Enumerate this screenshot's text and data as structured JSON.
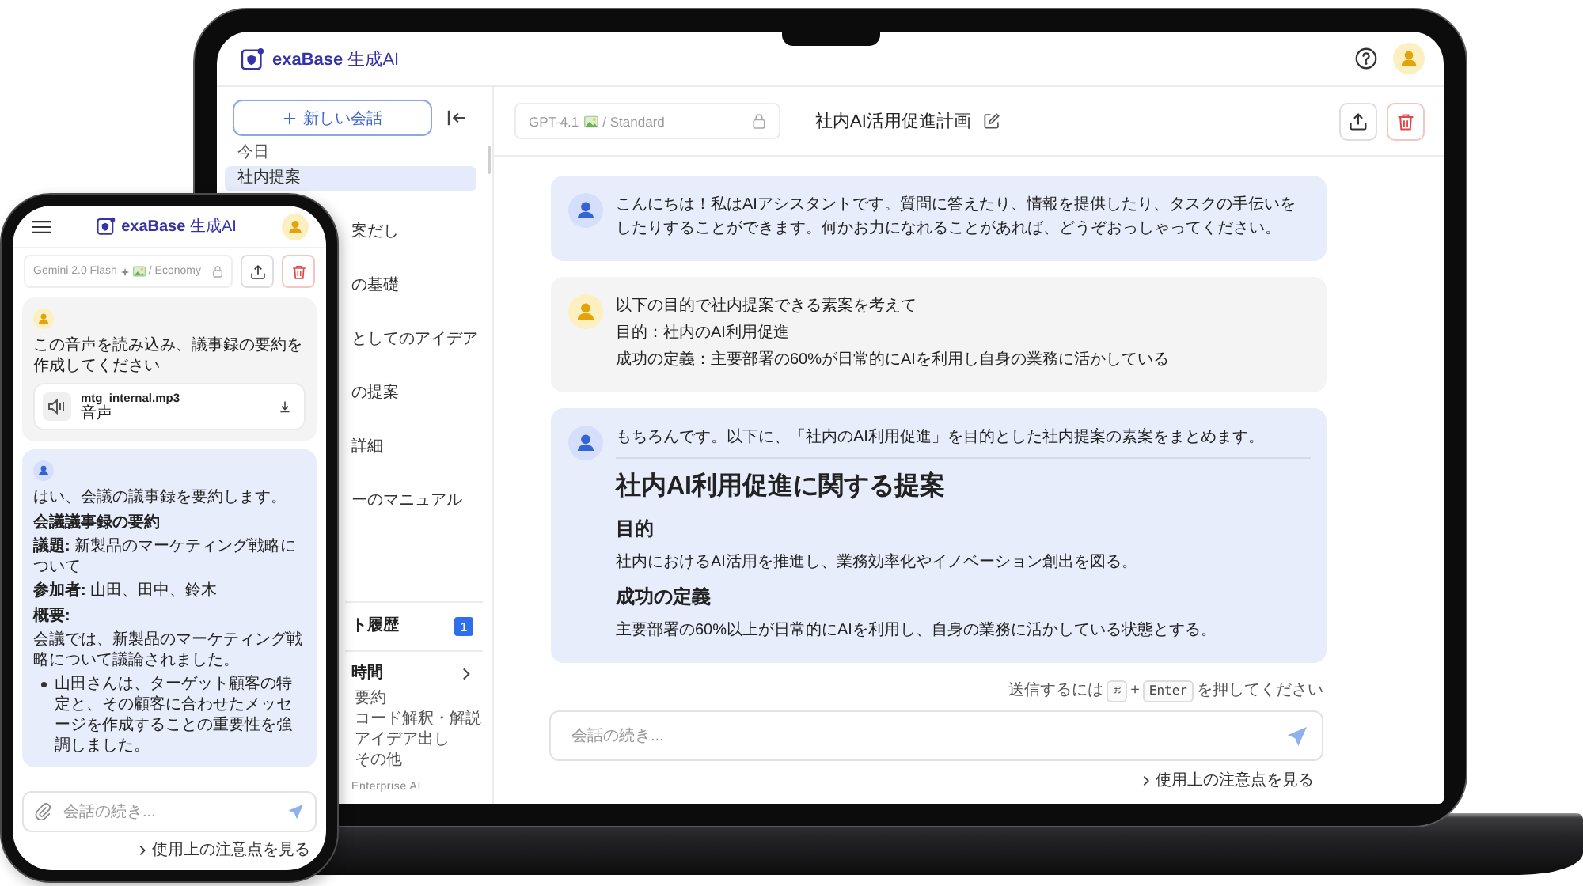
{
  "laptop": {
    "app_bar": {
      "logo": "**exaBase** 生成AI"
    },
    "sidebar": {
      "new_chat": "新しい会話",
      "section_label": "今日",
      "items": [
        {
          "label": "社内提案",
          "selected": true
        },
        {
          "label": "案だし",
          "selected": false
        },
        {
          "label": "の基礎",
          "selected": false
        },
        {
          "label": "としてのアイデア",
          "selected": false
        },
        {
          "label": "の提案",
          "selected": false
        },
        {
          "label": "詳細",
          "selected": false
        },
        {
          "label": "ーのマニュアル",
          "selected": false
        }
      ],
      "history": {
        "label": "ト履歴",
        "badge": "1"
      },
      "shortcuts": {
        "label": "時間",
        "items": [
          "要約",
          "コード解釈・解説",
          "アイデア出し",
          "その他"
        ]
      },
      "footer": "Enterprise AI"
    },
    "header": {
      "model": {
        "name": "GPT-4.1",
        "plan": "/ Standard"
      },
      "title": "社内AI活用促進計画"
    },
    "messages": [
      {
        "kind": "assistant",
        "blocks": [
          {
            "kind": "paragraph",
            "text": "こんにちは！私はAIアシスタントです。質問に答えたり、情報を提供したり、タスクの手伝いをしたりすることができます。何かお力になれることがあれば、どうぞおっしゃってください。"
          }
        ]
      },
      {
        "kind": "user",
        "blocks": [
          {
            "kind": "paragraph",
            "text": "以下の目的で社内提案できる素案を考えて"
          },
          {
            "kind": "paragraph",
            "text": "目的：社内のAI利用促進"
          },
          {
            "kind": "paragraph",
            "text": "成功の定義：主要部署の60%が日常的にAIを利用し自身の業務に活かしている"
          }
        ]
      },
      {
        "kind": "assistant",
        "blocks": [
          {
            "kind": "paragraph",
            "text": "もちろんです。以下に、「社内のAI利用促進」を目的とした社内提案の素案をまとめます。"
          },
          {
            "kind": "divider"
          },
          {
            "kind": "heading",
            "text": "社内AI利用促進に関する提案"
          },
          {
            "kind": "subheading",
            "text": "目的"
          },
          {
            "kind": "paragraph",
            "text": "社内におけるAI活用を推進し、業務効率化やイノベーション創出を図る。"
          },
          {
            "kind": "subheading",
            "text": "成功の定義"
          },
          {
            "kind": "paragraph",
            "text": "主要部署の60%以上が日常的にAIを利用し、自身の業務に活かしている状態とする。"
          }
        ]
      }
    ],
    "composer": {
      "hint": {
        "before": "送信するには",
        "keys": [
          "⌘",
          "Enter"
        ],
        "joiner": "+",
        "after": "を押してください"
      },
      "placeholder": "会話の続き...",
      "notice_link": "使用上の注意点を見る"
    }
  },
  "phone": {
    "app_bar": {
      "logo": "**exaBase** 生成AI"
    },
    "header": {
      "model": {
        "name": "Gemini 2.0 Flash",
        "plan": "/ Economy"
      }
    },
    "messages": [
      {
        "kind": "user",
        "blocks": [
          {
            "kind": "paragraph",
            "text": "この音声を読み込み、議事録の要約を作成してください"
          },
          {
            "kind": "attachment",
            "name": "mtg_internal.mp3",
            "type_label": "音声"
          }
        ]
      },
      {
        "kind": "assistant",
        "blocks": [
          {
            "kind": "paragraph",
            "text": "はい、会議の議事録を要約します。"
          },
          {
            "kind": "strong",
            "text": "会議議事録の要約"
          },
          {
            "kind": "paragraph",
            "text": "**議題:** 新製品のマーケティング戦略について"
          },
          {
            "kind": "paragraph",
            "text": "**参加者:** 山田、田中、鈴木"
          },
          {
            "kind": "strong",
            "text": "概要:"
          },
          {
            "kind": "paragraph",
            "text": "会議では、新製品のマーケティング戦略について議論されました。"
          },
          {
            "kind": "bullets",
            "items": [
              "山田さんは、ターゲット顧客の特定と、その顧客に合わせたメッセージを作成することの重要性を強調しました。"
            ]
          }
        ]
      }
    ],
    "composer": {
      "placeholder": "会話の続き...",
      "notice_link": "使用上の注意点を見る"
    }
  }
}
